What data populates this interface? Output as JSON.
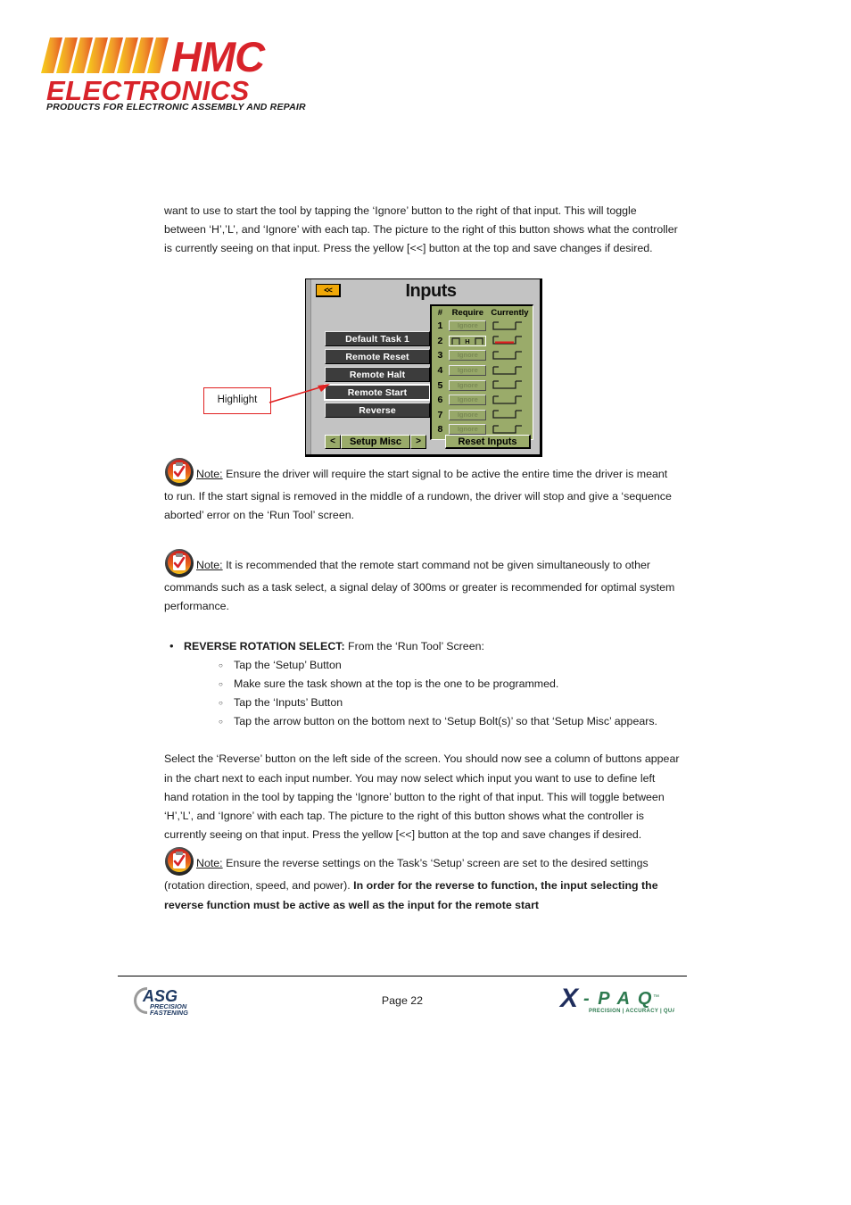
{
  "company_logo": {
    "name": "HMC",
    "subtitle": "ELECTRONICS",
    "tagline": "PRODUCTS FOR ELECTRONIC ASSEMBLY AND REPAIR",
    "colors": {
      "red": "#d8232a",
      "gold": "#f5c518",
      "orange": "#ef8022"
    }
  },
  "paragraphs": {
    "intro": "want to use to start the tool by tapping the ‘Ignore’ button to the right of that input.  This will toggle between ‘H’,’L’, and ‘Ignore’ with each tap.  The picture to the right of this button shows what the controller is currently seeing on that input.  Press the yellow [<<] button at the top and save changes if desired.",
    "reverse_body": "Select the ‘Reverse’ button on the left side of the screen.  You should now see a column of buttons appear in the chart next to each input number.  You may now select which input you want to use to define left hand rotation in the tool by tapping the ‘Ignore’ button to the right of that input.  This will toggle between ‘H’,’L’, and ‘Ignore’ with each tap.  The picture to the right of this button shows what the controller is currently seeing on that input.  Press the yellow [<<] button at the top and save changes if desired."
  },
  "callout": {
    "label": "Highlight",
    "border_color": "#e02020",
    "target": "Remote Start"
  },
  "device_screen": {
    "title": "Inputs",
    "back_button": "<<",
    "back_button_color": "#f0a808",
    "buttons": [
      {
        "label": "Default Task 1",
        "selected": false
      },
      {
        "label": "Remote Reset",
        "selected": false
      },
      {
        "label": "Remote Halt",
        "selected": false
      },
      {
        "label": "Remote Start",
        "selected": true
      },
      {
        "label": "Reverse",
        "selected": false
      }
    ],
    "bottom_nav": {
      "prev": "<",
      "label": "Setup Misc",
      "next": ">"
    },
    "reset_button": "Reset Inputs",
    "table": {
      "headers": [
        "#",
        "Require",
        "Currently"
      ],
      "rows": [
        {
          "num": "1",
          "require": "Ignore",
          "require_state": "ignore",
          "currently": "low",
          "currently_active": false
        },
        {
          "num": "2",
          "require": "H",
          "require_state": "high",
          "currently": "low",
          "currently_active": true
        },
        {
          "num": "3",
          "require": "Ignore",
          "require_state": "ignore",
          "currently": "low",
          "currently_active": false
        },
        {
          "num": "4",
          "require": "Ignore",
          "require_state": "ignore",
          "currently": "low",
          "currently_active": false
        },
        {
          "num": "5",
          "require": "Ignore",
          "require_state": "ignore",
          "currently": "low",
          "currently_active": false
        },
        {
          "num": "6",
          "require": "Ignore",
          "require_state": "ignore",
          "currently": "low",
          "currently_active": false
        },
        {
          "num": "7",
          "require": "Ignore",
          "require_state": "ignore",
          "currently": "low",
          "currently_active": false
        },
        {
          "num": "8",
          "require": "Ignore",
          "require_state": "ignore",
          "currently": "low",
          "currently_active": false
        }
      ]
    },
    "colors": {
      "background": "#c3c3c3",
      "button": "#3c3c3c",
      "panel_green": "#9aab6a",
      "active_red": "#e02020"
    }
  },
  "notes": {
    "label": "Note:",
    "note1": "Ensure the driver will require the start signal to be active the entire time the driver is meant to run.  If the start signal is removed in the middle of a rundown, the driver will stop and give a ‘sequence aborted’ error on the ‘Run Tool’ screen.",
    "note2": "It is recommended that the remote start command not be given simultaneously to other commands such as a task select, a signal delay of 300ms or greater is recommended for optimal system performance.",
    "note3_plain": "Ensure the reverse settings on the Task’s ‘Setup’ screen are set to the desired settings (rotation direction, speed, and power).  ",
    "note3_bold": "In order for the reverse to function, the input selecting the reverse function must be active as well as the input for the remote start"
  },
  "reverse_section": {
    "heading_bold": "REVERSE  ROTATION SELECT:",
    "heading_rest": " From the ‘Run Tool’ Screen:",
    "steps": [
      "Tap the ‘Setup’ Button",
      "Make sure the task shown at the top is the one to be programmed.",
      "Tap the ‘Inputs’ Button",
      "Tap the arrow button on the bottom next to ‘Setup Bolt(s)’ so that ‘Setup Misc’ appears."
    ]
  },
  "footer": {
    "page_label": "Page 22",
    "asg_logo": {
      "name": "ASG",
      "line1": "PRECISION",
      "line2": "FASTENING"
    },
    "xpaq_logo": {
      "x": "X",
      "name": "- P A Q",
      "tm": "™",
      "tagline": "PRECISION | ACCURACY | QUALITY"
    }
  }
}
